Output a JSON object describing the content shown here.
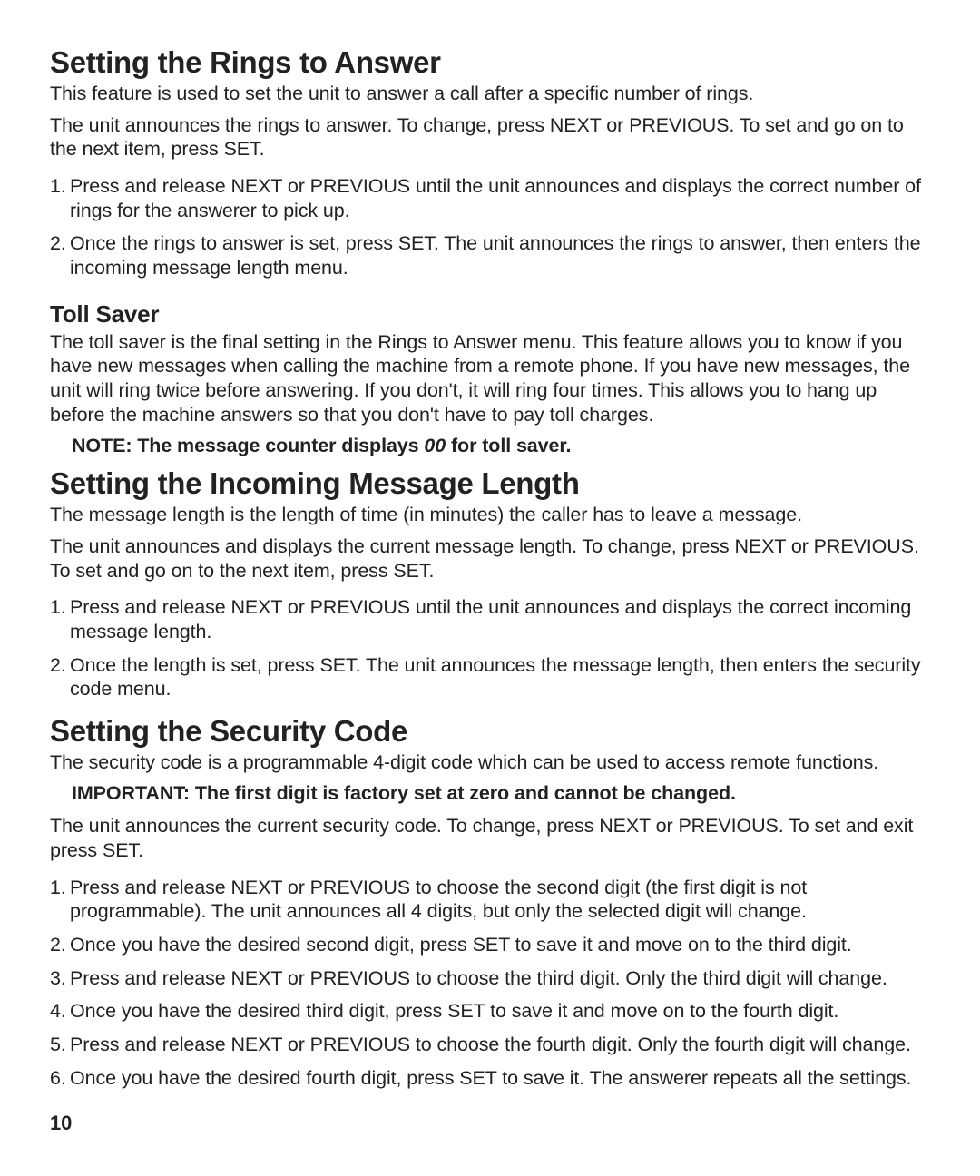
{
  "page_number": "10",
  "s1": {
    "heading": "Setting the Rings to Answer",
    "p1": "This feature is used to set the unit to answer a call after a specific number of rings.",
    "p2": "The unit announces the rings to answer. To change, press NEXT or PREVIOUS. To set and go on to the next item, press SET.",
    "li1": "Press and release NEXT or PREVIOUS until the unit announces and displays the correct number of rings for the answerer to pick up.",
    "li2": "Once the rings to answer is set, press SET. The unit announces the rings to answer, then enters the incoming message length menu."
  },
  "s1a": {
    "heading": "Toll Saver",
    "p1": "The toll saver is the final setting in the Rings to Answer menu. This feature allows you to know if you have new messages when calling the machine from a remote phone. If you have new messages, the unit will ring twice before answering.  If you don't, it will ring four times. This allows you to hang up before the machine answers so that you don't have to pay toll charges.",
    "note_prefix": "NOTE: The message counter displays ",
    "note_value": "00",
    "note_suffix": "  for toll saver."
  },
  "s2": {
    "heading": "Setting the Incoming Message Length",
    "p1": "The message length is the length of time (in minutes) the caller has to leave a message.",
    "p2": "The unit announces and displays the current message length. To change, press NEXT or PREVIOUS. To set and go on to the next item, press SET.",
    "li1": "Press and release NEXT or PREVIOUS until the unit announces and displays the correct incoming message length.",
    "li2": "Once the length is set, press SET. The unit announces the message length, then enters the security code menu."
  },
  "s3": {
    "heading": "Setting the Security Code",
    "p1": "The security code is a programmable 4-digit code which can be used to access remote functions.",
    "important": "IMPORTANT: The first digit is factory set at zero and cannot be changed.",
    "p2": "The unit announces the current security code. To change, press NEXT or PREVIOUS. To set and exit press SET.",
    "li1": "Press and release NEXT or PREVIOUS to choose the second digit (the first digit is not programmable). The unit announces all 4 digits, but only the selected digit will change.",
    "li2": "Once you have the desired second digit, press SET to save it and move on to the third digit.",
    "li3": "Press and release NEXT or PREVIOUS to choose the third digit. Only the third digit will change.",
    "li4": "Once you have the desired third digit, press SET to save it and move on to the fourth digit.",
    "li5": "Press and release NEXT or PREVIOUS to choose the fourth digit. Only the fourth digit will change.",
    "li6": "Once you have the desired fourth digit, press SET to save it. The answerer repeats all the settings."
  }
}
